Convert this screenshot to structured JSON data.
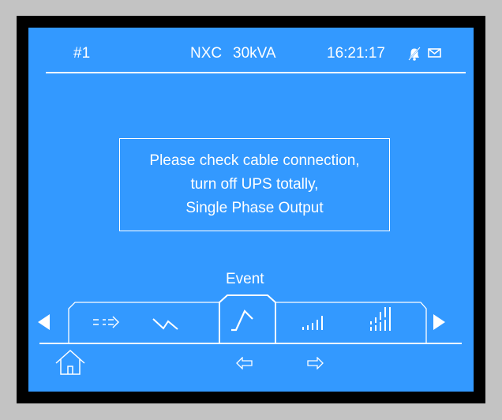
{
  "header": {
    "unit_id": "#1",
    "model": "NXC",
    "rating": "30kVA",
    "time": "16:21:17",
    "alarm_icon": "muted-bell-icon",
    "message_icon": "envelope-icon"
  },
  "dialog": {
    "lines": [
      "Please check cable connection,",
      "turn off UPS totally,",
      "Single Phase Output"
    ]
  },
  "tabs": {
    "active_caption": "Event",
    "items": [
      {
        "icon": "flow-arrows-icon"
      },
      {
        "icon": "zigzag-waveform-icon"
      },
      {
        "icon": "event-waveform-icon",
        "active": true
      },
      {
        "icon": "small-bar-graph-icon"
      },
      {
        "icon": "large-bar-graph-icon"
      }
    ]
  },
  "footer": {
    "home_icon": "home-icon",
    "prev_icon": "left-arrow-icon",
    "next_icon": "right-arrow-icon"
  },
  "colors": {
    "screen": "#3399ff",
    "bezel": "#000000",
    "foreground": "#ffffff",
    "surround": "#c3c3c3"
  }
}
